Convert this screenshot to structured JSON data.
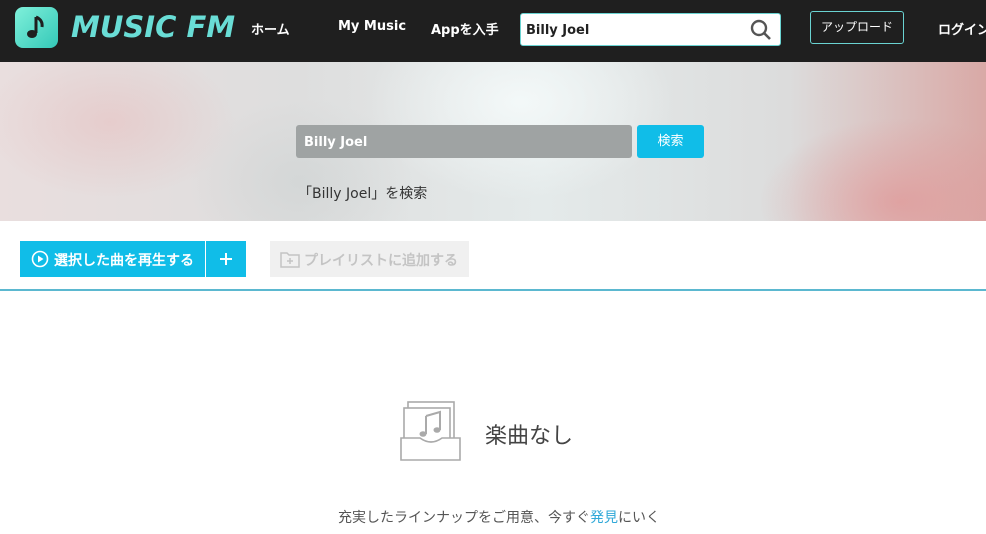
{
  "header": {
    "brand": "MUSIC FM",
    "nav": {
      "home": "ホーム",
      "my_music": "My Music",
      "app": "Appを入手"
    },
    "search_value": "Billy Joel",
    "upload": "アップロード",
    "login": "ログイン"
  },
  "hero": {
    "search_value": "Billy Joel",
    "search_button": "検索",
    "caption": "「Billy Joel」を検索"
  },
  "toolbar": {
    "play_selected": "選択した曲を再生する",
    "add_to_playlist": "プレイリストに追加する"
  },
  "empty_state": {
    "title": "楽曲なし",
    "desc_prefix": "充実したラインナップをご用意、今すぐ",
    "desc_link": "発見",
    "desc_suffix": "にいく"
  },
  "colors": {
    "accent": "#10bde8",
    "header_bg": "#1f1f1f",
    "brand": "#69ddd6"
  }
}
